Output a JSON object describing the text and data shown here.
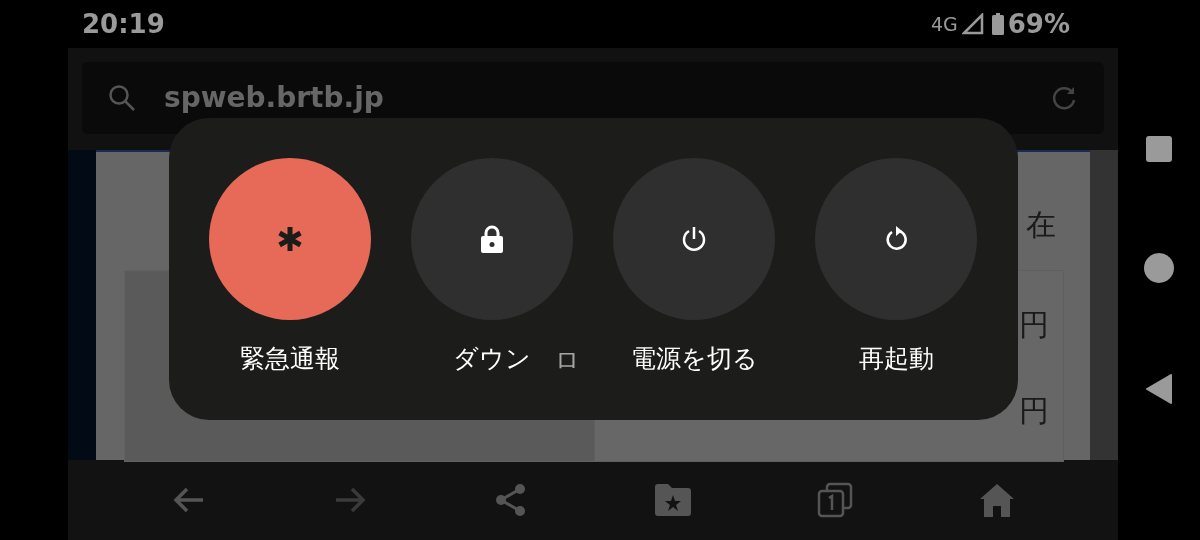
{
  "status_bar": {
    "time": "20:19",
    "network": "4G",
    "battery": "69%"
  },
  "address_bar": {
    "url": "spweb.brtb.jp"
  },
  "page": {
    "heading": "在",
    "prices": [
      "円",
      "円"
    ]
  },
  "power_menu": {
    "actions": [
      {
        "kind": "emergency",
        "label": "緊急通報"
      },
      {
        "kind": "lockdown",
        "label": "ダウン"
      },
      {
        "kind": "power_off",
        "label": "電源を切る"
      },
      {
        "kind": "restart",
        "label": "再起動"
      }
    ],
    "next_label_fragment": "ロ"
  }
}
